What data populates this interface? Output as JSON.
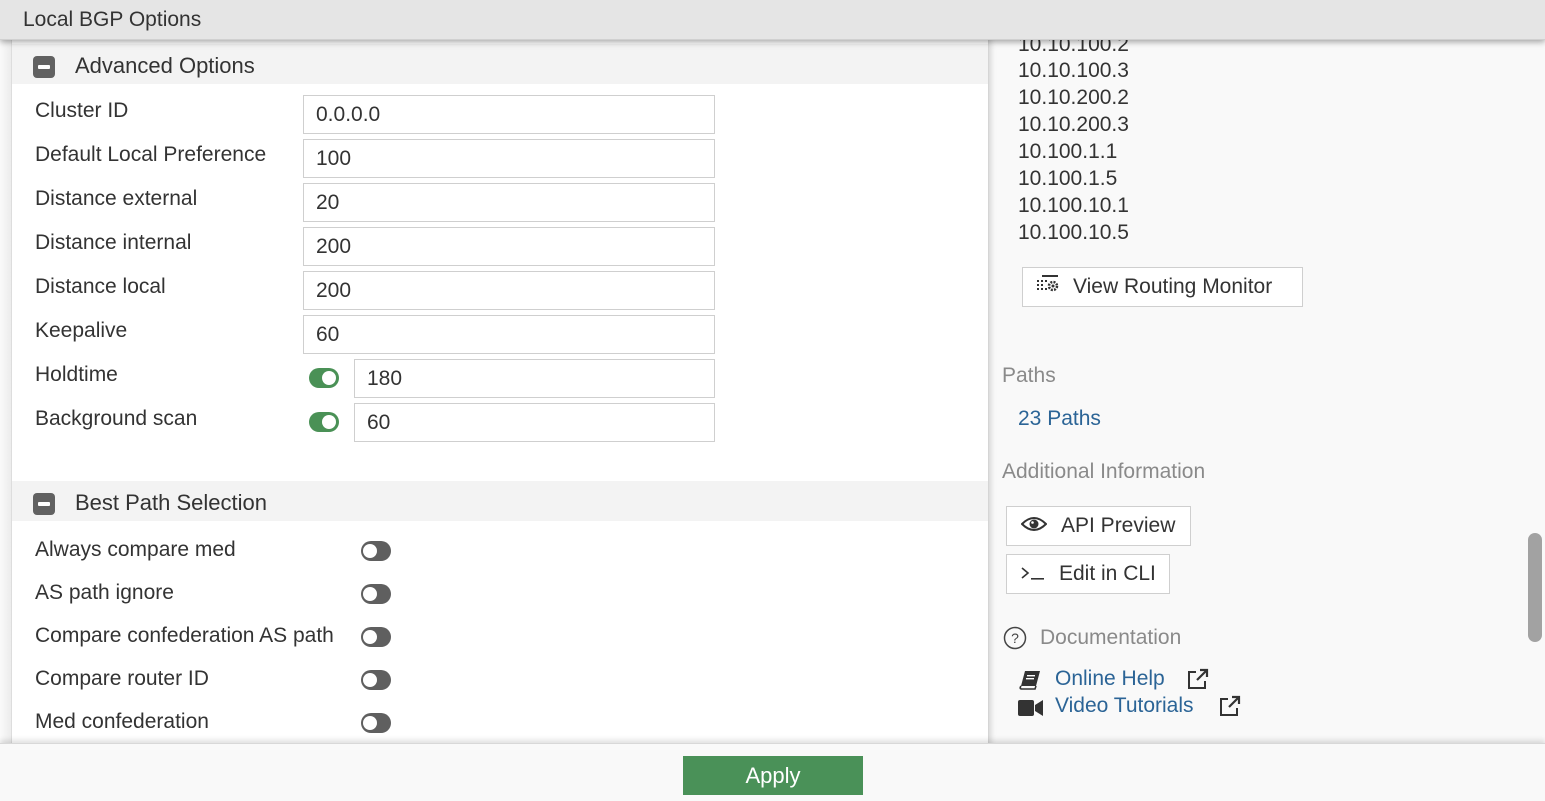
{
  "header": {
    "title": "Local BGP Options"
  },
  "advanced_options": {
    "title": "Advanced Options",
    "fields": [
      {
        "label": "Cluster ID",
        "value": "0.0.0.0"
      },
      {
        "label": "Default Local Preference",
        "value": "100"
      },
      {
        "label": "Distance external",
        "value": "20"
      },
      {
        "label": "Distance internal",
        "value": "200"
      },
      {
        "label": "Distance local",
        "value": "200"
      },
      {
        "label": "Keepalive",
        "value": "60"
      },
      {
        "label": "Holdtime",
        "value": "180",
        "enabled": true
      },
      {
        "label": "Background scan",
        "value": "60",
        "enabled": true
      }
    ]
  },
  "best_path_selection": {
    "title": "Best Path Selection",
    "toggles": [
      {
        "label": "Always compare med",
        "enabled": false
      },
      {
        "label": "AS path ignore",
        "enabled": false
      },
      {
        "label": "Compare confederation AS path",
        "enabled": false
      },
      {
        "label": "Compare router ID",
        "enabled": false
      },
      {
        "label": "Med confederation",
        "enabled": false
      }
    ]
  },
  "sidebar": {
    "ip_list": [
      "10.10.100.2",
      "10.10.100.3",
      "10.10.200.2",
      "10.10.200.3",
      "10.100.1.1",
      "10.100.1.5",
      "10.100.10.1",
      "10.100.10.5"
    ],
    "view_routing_monitor_label": "View Routing Monitor",
    "paths_heading": "Paths",
    "paths_link": "23 Paths",
    "additional_info_heading": "Additional Information",
    "api_preview_label": "API Preview",
    "edit_cli_label": "Edit in CLI",
    "documentation_heading": "Documentation",
    "online_help_label": "Online Help",
    "video_tutorials_label": "Video Tutorials"
  },
  "footer": {
    "apply_label": "Apply"
  },
  "colors": {
    "accent_green": "#4a9158",
    "link_blue": "#2b6496",
    "toggle_off": "#5f5f5f"
  }
}
